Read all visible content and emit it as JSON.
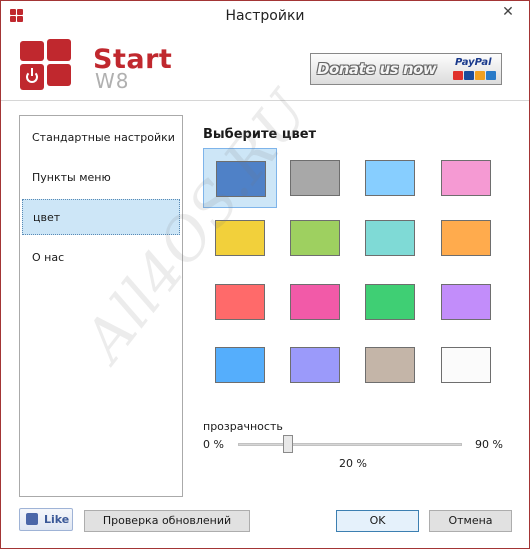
{
  "window": {
    "title": "Настройки"
  },
  "header": {
    "brand_start": "Start",
    "brand_w8": "W8",
    "donate_label": "Donate us now",
    "paypal_label": "PayPal"
  },
  "sidebar": {
    "items": [
      {
        "label": "Стандартные настройки",
        "selected": false
      },
      {
        "label": "Пункты меню",
        "selected": false
      },
      {
        "label": "цвет",
        "selected": true
      },
      {
        "label": "О нас",
        "selected": false
      }
    ]
  },
  "color_panel": {
    "title": "Выберите цвет",
    "selected_index": 0,
    "swatches": [
      {
        "color": "#4f81c7"
      },
      {
        "color": "#a8a8a8"
      },
      {
        "color": "#87ceff"
      },
      {
        "color": "#f59ad3"
      },
      {
        "color": "#f2d03b"
      },
      {
        "color": "#9ed060"
      },
      {
        "color": "#7fdad6"
      },
      {
        "color": "#ffab4d"
      },
      {
        "color": "#ff6a6a"
      },
      {
        "color": "#f25aa8"
      },
      {
        "color": "#3fcf74"
      },
      {
        "color": "#c28dfa"
      },
      {
        "color": "#55aefc"
      },
      {
        "color": "#9b9afa"
      },
      {
        "color": "#c4b5a8"
      },
      {
        "color": "#fbfbfb"
      }
    ]
  },
  "transparency": {
    "label": "прозрачность",
    "min_label": "0 %",
    "max_label": "90 %",
    "current_label": "20 %",
    "value": 20,
    "min": 0,
    "max": 90
  },
  "footer": {
    "like_label": "Like",
    "check_updates_label": "Проверка обновлений",
    "ok_label": "OK",
    "cancel_label": "Отмена"
  },
  "watermark": "All4OS.RU"
}
